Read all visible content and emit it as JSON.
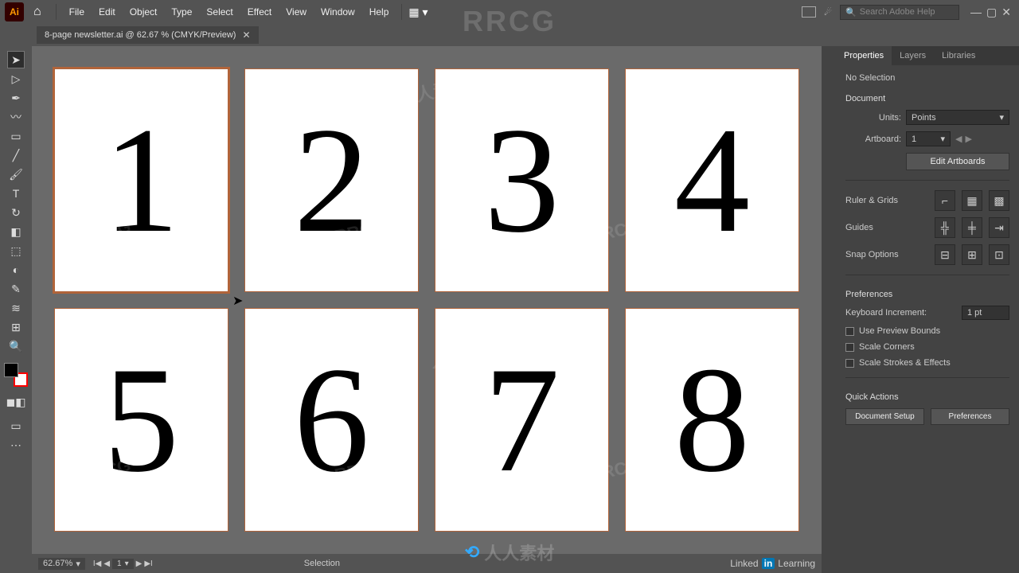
{
  "menubar": {
    "app_abbrev": "Ai",
    "items": [
      "File",
      "Edit",
      "Object",
      "Type",
      "Select",
      "Effect",
      "View",
      "Window",
      "Help"
    ],
    "search_placeholder": "Search Adobe Help"
  },
  "tab": {
    "title": "8-page newsletter.ai @ 62.67 % (CMYK/Preview)"
  },
  "artboards": [
    "1",
    "2",
    "3",
    "4",
    "5",
    "6",
    "7",
    "8"
  ],
  "selected_artboard": 0,
  "statusbar": {
    "zoom": "62.67%",
    "artboard": "1",
    "mode": "Selection"
  },
  "properties": {
    "tabs": [
      "Properties",
      "Layers",
      "Libraries"
    ],
    "selection_state": "No Selection",
    "section_document": "Document",
    "units_label": "Units:",
    "units_value": "Points",
    "artboard_label": "Artboard:",
    "artboard_value": "1",
    "edit_artboards": "Edit Artboards",
    "ruler_grids": "Ruler & Grids",
    "guides": "Guides",
    "snap_options": "Snap Options",
    "preferences": "Preferences",
    "keyboard_inc_label": "Keyboard Increment:",
    "keyboard_inc_value": "1 pt",
    "chk_preview": "Use Preview Bounds",
    "chk_scale_corners": "Scale Corners",
    "chk_scale_strokes": "Scale Strokes & Effects",
    "quick_actions": "Quick Actions",
    "doc_setup": "Document Setup",
    "prefs_btn": "Preferences"
  },
  "tools": [
    "selection",
    "direct-selection",
    "pen",
    "curvature",
    "rect",
    "line",
    "brush",
    "type",
    "rotate",
    "scale",
    "eraser",
    "shapebuilder",
    "gradient",
    "eyedropper",
    "blend",
    "symbol",
    "artboard",
    "zoom"
  ],
  "watermark": {
    "big": "RRCG",
    "small": "人人素材",
    "bottom": "人人素材"
  },
  "branding": {
    "linked": "Linked",
    "in": "in",
    "learning": "Learning"
  }
}
